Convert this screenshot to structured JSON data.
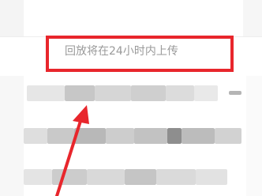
{
  "notice": {
    "text": "回放将在24小时内上传"
  },
  "colors": {
    "highlight": "#e8262c",
    "notice_text": "#9a9a9a",
    "background": "#ffffff"
  },
  "icons": {
    "annotation_arrow": "red-arrow-pointing-up"
  }
}
